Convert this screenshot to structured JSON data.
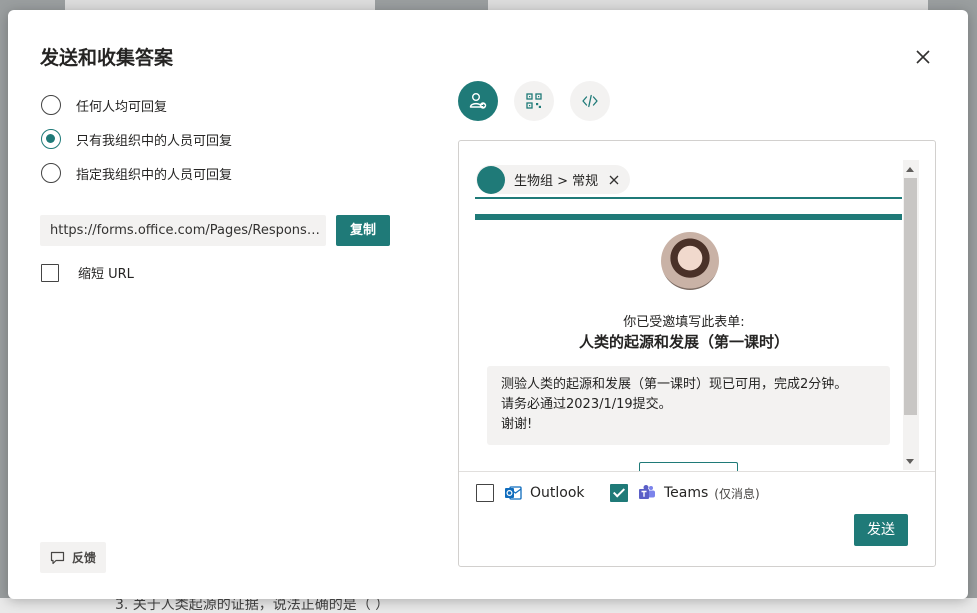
{
  "dialog": {
    "title": "发送和收集答案",
    "close_icon": "close-icon"
  },
  "access_options": [
    {
      "label": "任何人均可回复",
      "checked": false
    },
    {
      "label": "只有我组织中的人员可回复",
      "checked": true
    },
    {
      "label": "指定我组织中的人员可回复",
      "checked": false
    }
  ],
  "link": {
    "url": "https://forms.office.com/Pages/ResponsePage.aspx",
    "copy_label": "复制",
    "shorten_label": "缩短 URL",
    "shorten_checked": false
  },
  "feedback_label": "反馈",
  "share_tabs": [
    {
      "icon": "person-send-icon",
      "active": true
    },
    {
      "icon": "qr-code-icon",
      "active": false
    },
    {
      "icon": "embed-code-icon",
      "active": false
    }
  ],
  "recipient": {
    "chip_label": "生物组 > 常规"
  },
  "email_preview": {
    "invite_text": "你已受邀填写此表单:",
    "form_title": "人类的起源和发展（第一课时）",
    "message_lines": [
      "测验人类的起源和发展（第一课时）现已可用，完成2分钟。",
      "请务必通过2023/1/19提交。",
      "谢谢!"
    ]
  },
  "channels": {
    "outlook_label": "Outlook",
    "outlook_checked": false,
    "teams_label": "Teams",
    "teams_sub": "(仅消息)",
    "teams_checked": true
  },
  "send_label": "发送",
  "background_text": "3. 关于人类起源的证据，说法正确的是（    ）",
  "colors": {
    "accent": "#1f7a78",
    "outlook": "#0f6cbd",
    "teams": "#5b5fc7"
  }
}
